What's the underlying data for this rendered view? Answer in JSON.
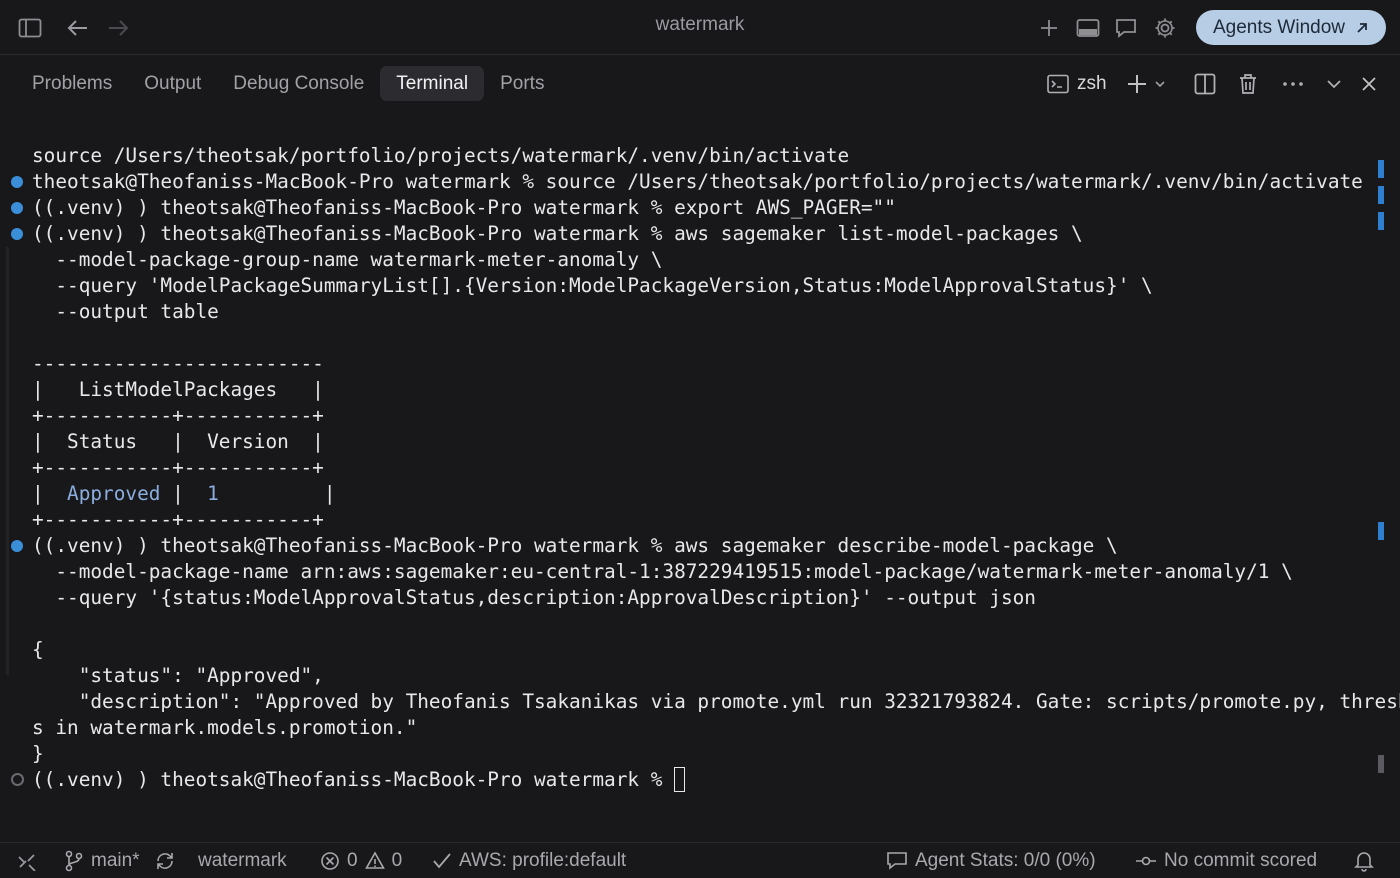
{
  "window": {
    "title": "watermark",
    "agents_button": "Agents Window"
  },
  "panel": {
    "tabs": [
      "Problems",
      "Output",
      "Debug Console",
      "Terminal",
      "Ports"
    ],
    "active_tab": "Terminal",
    "shell_label": "zsh"
  },
  "terminal": {
    "lines": [
      "source /Users/theotsak/portfolio/projects/watermark/.venv/bin/activate",
      "theotsak@Theofaniss-MacBook-Pro watermark % source /Users/theotsak/portfolio/projects/watermark/.venv/bin/activate",
      "((.venv) ) theotsak@Theofaniss-MacBook-Pro watermark % export AWS_PAGER=\"\"",
      "((.venv) ) theotsak@Theofaniss-MacBook-Pro watermark % aws sagemaker list-model-packages \\",
      "  --model-package-group-name watermark-meter-anomaly \\",
      "  --query 'ModelPackageSummaryList[].{Version:ModelPackageVersion,Status:ModelApprovalStatus}' \\",
      "  --output table",
      "",
      "-------------------------",
      "|   ListModelPackages   |",
      "+-----------+-----------+",
      "|  Status   |  Version  |",
      "+-----------+-----------+",
      "",
      "+-----------+-----------+",
      "((.venv) ) theotsak@Theofaniss-MacBook-Pro watermark % aws sagemaker describe-model-package \\",
      "  --model-package-name arn:aws:sagemaker:eu-central-1:387229419515:model-package/watermark-meter-anomaly/1 \\",
      "  --query '{status:ModelApprovalStatus,description:ApprovalDescription}' --output json",
      "",
      "{",
      "    \"status\": \"Approved\",",
      "    \"description\": \"Approved by Theofanis Tsakanikas via promote.yml run 32321793824. Gate: scripts/promote.py, threshold",
      "s in watermark.models.promotion.\"",
      "}",
      "((.venv) ) theotsak@Theofaniss-MacBook-Pro watermark % "
    ],
    "table_row": {
      "pre": "|  ",
      "status": "Approved",
      "mid": " |  ",
      "version": "1",
      "post": "         |"
    }
  },
  "statusbar": {
    "branch": "main*",
    "folder": "watermark",
    "errors": "0",
    "warnings": "0",
    "aws": "AWS: profile:default",
    "agent_stats": "Agent Stats: 0/0 (0%)",
    "commit": "No commit scored"
  },
  "colors": {
    "accent": "#3a8fd8",
    "background": "#18181b",
    "agents_button": "#b7cde6"
  }
}
